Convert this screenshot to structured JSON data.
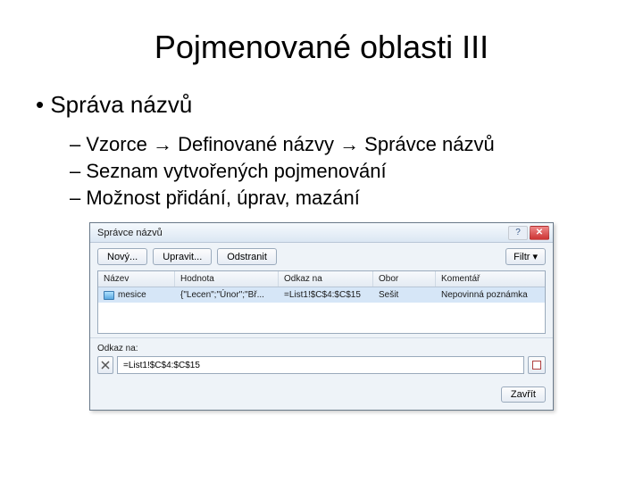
{
  "slide": {
    "title": "Pojmenované oblasti III",
    "bullet1": "Správa názvů",
    "bullet2a": "Vzorce ",
    "bullet2b": " Definované názvy ",
    "bullet2c": " Správce názvů",
    "arrow": "→",
    "bullet3": "Seznam vytvořených pojmenování",
    "bullet4": "Možnost přidání, úprav, mazání"
  },
  "dialog": {
    "title": "Správce názvů",
    "help_glyph": "?",
    "close_glyph": "✕",
    "buttons": {
      "new": "Nový...",
      "edit": "Upravit...",
      "delete": "Odstranit",
      "filter": "Filtr ▾",
      "close": "Zavřít"
    },
    "headers": {
      "name": "Název",
      "value": "Hodnota",
      "ref": "Odkaz na",
      "scope": "Obor",
      "comment": "Komentář"
    },
    "row": {
      "name": "mesice",
      "value": "{\"Lecen\";\"Únor\";\"Bř...",
      "ref": "=List1!$C$4:$C$15",
      "scope": "Sešit",
      "comment": "Nepovinná poznámka"
    },
    "ref_label": "Odkaz na:",
    "ref_value": "=List1!$C$4:$C$15"
  }
}
